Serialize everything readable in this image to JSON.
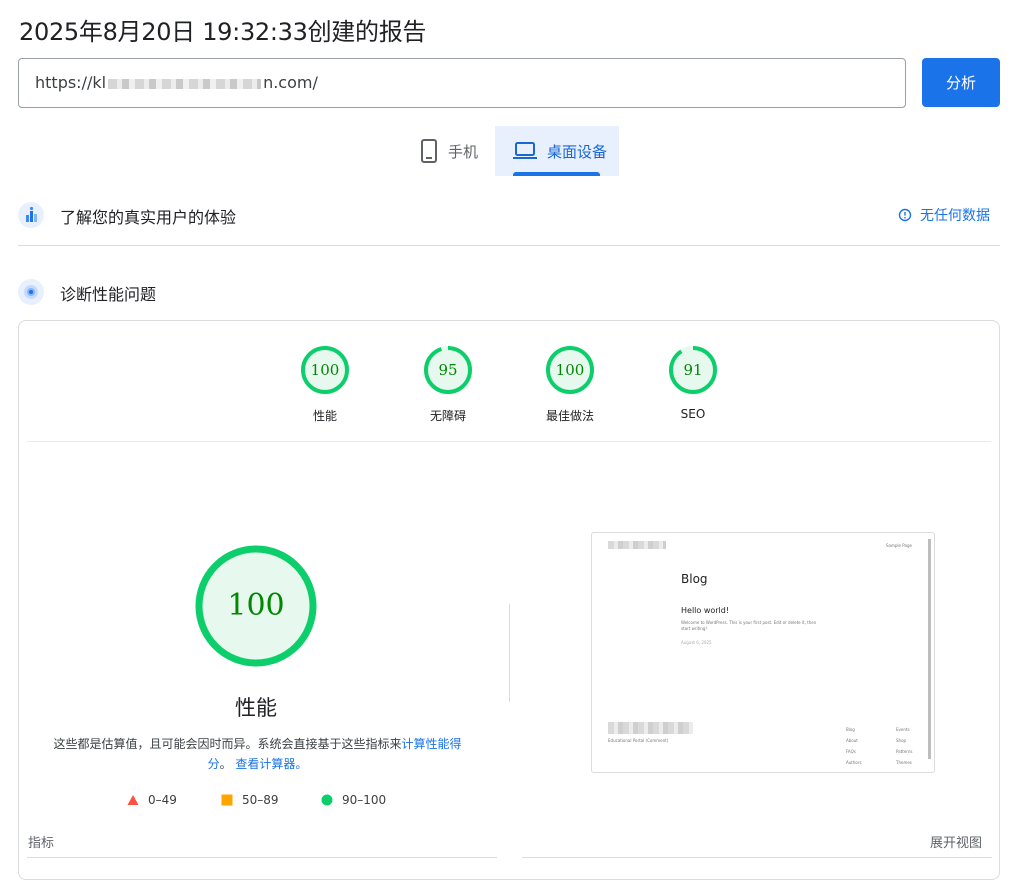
{
  "report": {
    "title": "2025年8月20日 19:32:33创建的报告"
  },
  "url_input": {
    "prefix": "https://kl",
    "suffix": "n.com/"
  },
  "analyze_button": {
    "label": "分析"
  },
  "device_tabs": [
    {
      "label": "手机",
      "icon": "phone-icon",
      "selected": false
    },
    {
      "label": "桌面设备",
      "icon": "laptop-icon",
      "selected": true
    }
  ],
  "crux_section": {
    "title": "了解您的真实用户的体验",
    "no_data_label": "无任何数据"
  },
  "diagnose_section": {
    "title": "诊断性能问题"
  },
  "categories": [
    {
      "score": "100",
      "label": "性能"
    },
    {
      "score": "95",
      "label": "无障碍"
    },
    {
      "score": "100",
      "label": "最佳做法"
    },
    {
      "score": "91",
      "label": "SEO"
    }
  ],
  "performance": {
    "score": "100",
    "label": "性能",
    "desc_text": "这些都是估算值，且可能会因时而异。系统会直接基于这些指标来",
    "calc_link": "计算性能得分",
    "desc_sep": "。",
    "calculator_link": "查看计算器。"
  },
  "legend": [
    {
      "range": "0–49",
      "shape": "triangle",
      "color": "#ff4e42"
    },
    {
      "range": "50–89",
      "shape": "square",
      "color": "#ffa400"
    },
    {
      "range": "90–100",
      "shape": "circle",
      "color": "#0cce6b"
    }
  ],
  "screenshot": {
    "nav_right": "Sample Page",
    "heading": "Blog",
    "post_title": "Hello world!",
    "post_excerpt": "Welcome to WordPress. This is your first post. Edit or delete it, then start writing!",
    "post_date": "August 6, 2025",
    "footer_tagline": "Educational Portal (Comment)",
    "footer_col1": [
      "Blog",
      "About",
      "FAQs",
      "Authors"
    ],
    "footer_col2": [
      "Events",
      "Shop",
      "Patterns",
      "Themes"
    ]
  },
  "metrics": {
    "label": "指标",
    "expand_label": "展开视图"
  },
  "colors": {
    "accent": "#1a73e8",
    "pass": "#0cce6b",
    "pass_bg": "#e7f8ee",
    "pass_text": "#008800"
  }
}
